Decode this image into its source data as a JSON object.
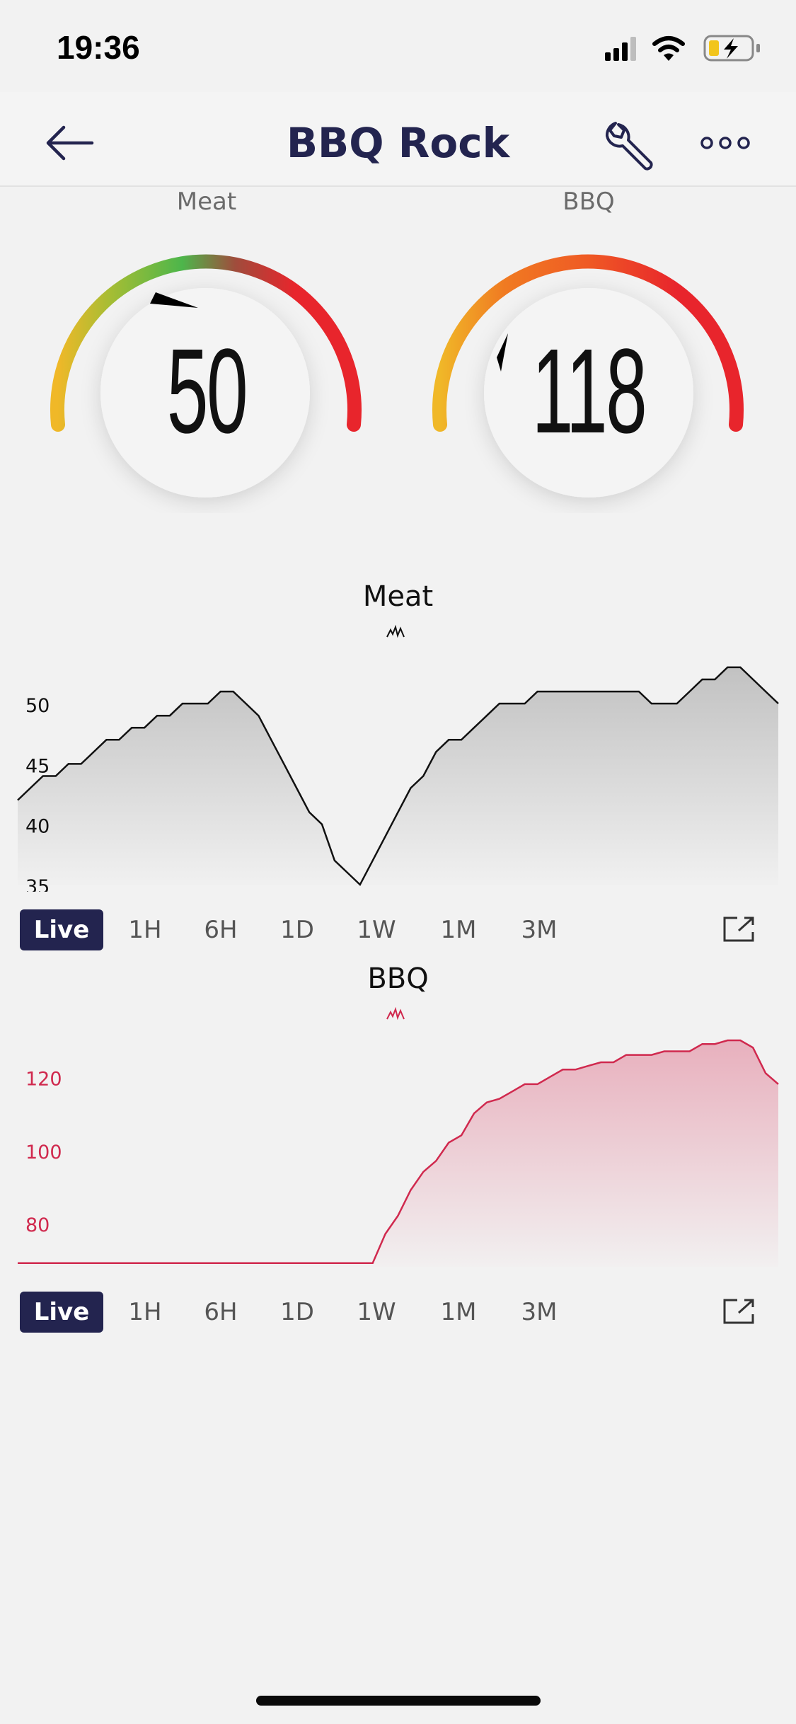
{
  "status_bar": {
    "time": "19:36"
  },
  "header": {
    "title": "BBQ Rock",
    "back_icon": "arrow-left-icon",
    "settings_icon": "wrench-icon",
    "more_icon": "ellipsis-icon"
  },
  "gauges": [
    {
      "label": "Meat",
      "value": "50"
    },
    {
      "label": "BBQ",
      "value": "118"
    }
  ],
  "charts": {
    "meat": {
      "title": "Meat",
      "ranges": [
        "Live",
        "1H",
        "6H",
        "1D",
        "1W",
        "1M",
        "3M"
      ],
      "active_range": "Live"
    },
    "bbq": {
      "title": "BBQ",
      "ranges": [
        "Live",
        "1H",
        "6H",
        "1D",
        "1W",
        "1M",
        "3M"
      ],
      "active_range": "Live"
    }
  },
  "colors": {
    "accent": "#23244f",
    "meat_line": "#111111",
    "bbq_line": "#d0294e",
    "gauge_red": "#e8252c",
    "gauge_green": "#4db64b",
    "gauge_yellow": "#f0b828",
    "gauge_orange": "#f07a22"
  },
  "chart_data": [
    {
      "type": "area",
      "title": "Meat",
      "ylim": [
        35,
        52
      ],
      "yticks": [
        35,
        40,
        45,
        50
      ],
      "values": [
        42,
        43,
        44,
        44,
        45,
        45,
        46,
        47,
        47,
        48,
        48,
        49,
        49,
        50,
        50,
        50,
        51,
        51,
        50,
        49,
        47,
        45,
        43,
        41,
        40,
        37,
        36,
        35,
        37,
        39,
        41,
        43,
        44,
        46,
        47,
        47,
        48,
        49,
        50,
        50,
        50,
        51,
        51,
        51,
        51,
        51,
        51,
        51,
        51,
        51,
        50,
        50,
        50,
        51,
        52,
        52,
        53,
        53,
        52,
        51,
        50
      ]
    },
    {
      "type": "area",
      "title": "BBQ",
      "ylim": [
        68,
        130
      ],
      "yticks": [
        80,
        100,
        120
      ],
      "values": [
        69,
        69,
        69,
        69,
        69,
        69,
        69,
        69,
        69,
        69,
        69,
        69,
        69,
        69,
        69,
        69,
        69,
        69,
        69,
        69,
        69,
        69,
        69,
        69,
        69,
        69,
        69,
        69,
        69,
        77,
        82,
        89,
        94,
        97,
        102,
        104,
        110,
        113,
        114,
        116,
        118,
        118,
        120,
        122,
        122,
        123,
        124,
        124,
        126,
        126,
        126,
        127,
        127,
        127,
        129,
        129,
        130,
        130,
        128,
        121,
        118
      ]
    }
  ]
}
